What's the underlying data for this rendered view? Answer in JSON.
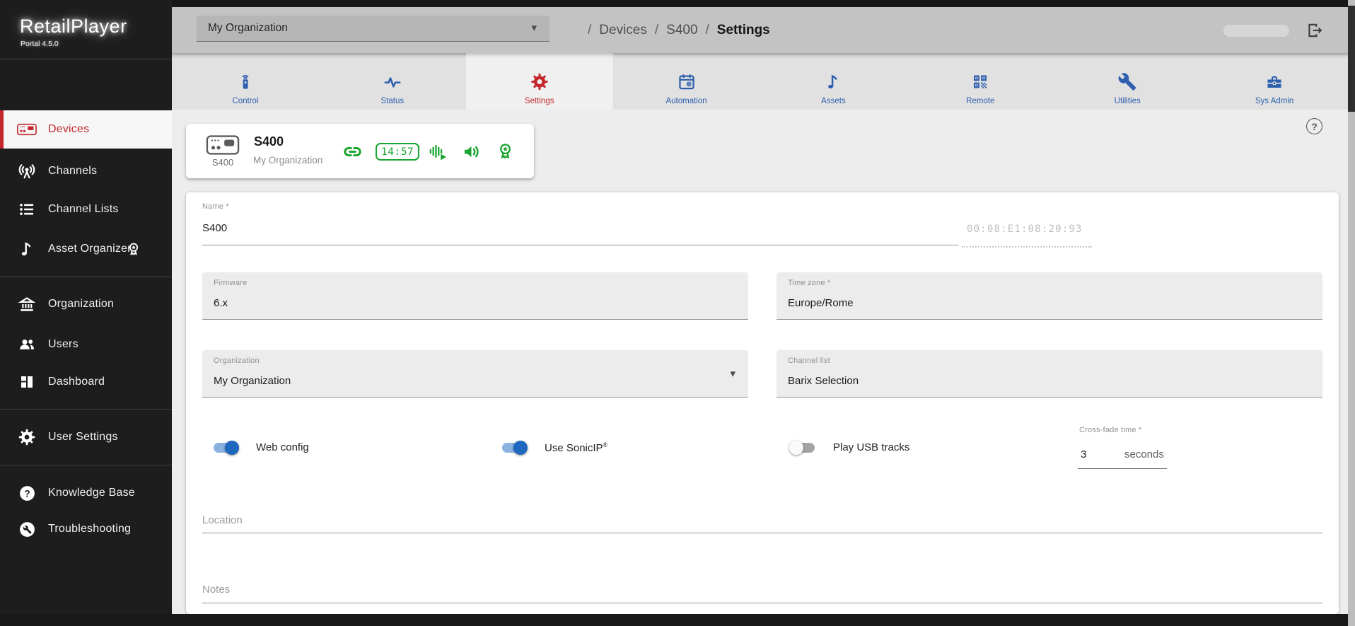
{
  "brand": {
    "title": "RetailPlayer",
    "subtitle": "Portal 4.5.0"
  },
  "topbar": {
    "org_selector_value": "My Organization",
    "breadcrumb": {
      "separator": "/",
      "crumbs": [
        "Devices",
        "S400",
        "Settings"
      ]
    }
  },
  "sidebar": {
    "items": [
      {
        "label": "Devices",
        "icon": "device-player-icon",
        "active": true
      },
      {
        "label": "Channels",
        "icon": "broadcast-icon",
        "active": false
      },
      {
        "label": "Channel Lists",
        "icon": "channel-list-icon",
        "active": false
      },
      {
        "label": "Asset Organizer",
        "icon": "music-note-icon",
        "badge_icon": "certificate-badge-icon",
        "active": false
      },
      {
        "label": "Organization",
        "icon": "bank-icon",
        "active": false
      },
      {
        "label": "Users",
        "icon": "users-icon",
        "active": false
      },
      {
        "label": "Dashboard",
        "icon": "dashboard-icon",
        "active": false
      },
      {
        "label": "User Settings",
        "icon": "gear-icon",
        "active": false
      },
      {
        "label": "Knowledge Base",
        "icon": "help-circle-icon",
        "active": false
      },
      {
        "label": "Troubleshooting",
        "icon": "wrench-circle-icon",
        "active": false
      }
    ]
  },
  "tabs": [
    {
      "label": "Control",
      "icon": "remote-control-icon",
      "active": false
    },
    {
      "label": "Status",
      "icon": "pulse-icon",
      "active": false
    },
    {
      "label": "Settings",
      "icon": "gear-icon",
      "active": true
    },
    {
      "label": "Automation",
      "icon": "automation-calendar-icon",
      "active": false
    },
    {
      "label": "Assets",
      "icon": "music-note-icon",
      "active": false
    },
    {
      "label": "Remote",
      "icon": "qr-code-icon",
      "active": false
    },
    {
      "label": "Utilities",
      "icon": "wrench-icon",
      "active": false
    },
    {
      "label": "Sys Admin",
      "icon": "toolbox-icon",
      "active": false
    }
  ],
  "device_card": {
    "model_label": "S400",
    "title": "S400",
    "organization": "My Organization",
    "clock": "14:57",
    "status_icons": [
      "link-icon",
      "clock-badge",
      "audio-playing-icon",
      "speaker-icon",
      "certificate-badge-icon"
    ]
  },
  "help": {
    "label": "?"
  },
  "form": {
    "name": {
      "label": "Name *",
      "value": "S400"
    },
    "mac_address": "00:08:E1:08:20:93",
    "firmware": {
      "label": "Firmware",
      "value": "6.x"
    },
    "timezone": {
      "label": "Time zone *",
      "value": "Europe/Rome"
    },
    "organization": {
      "label": "Organization",
      "value": "My Organization"
    },
    "channel_list": {
      "label": "Channel list",
      "value": "Barix Selection"
    },
    "toggles": [
      {
        "label": "Web config",
        "on": true
      },
      {
        "label": "Use SonicIP",
        "reg_mark": "®",
        "on": true
      },
      {
        "label": "Play USB tracks",
        "on": false
      }
    ],
    "crossfade": {
      "label": "Cross-fade time *",
      "value": "3",
      "unit": "seconds"
    },
    "location": {
      "placeholder": "Location"
    },
    "notes": {
      "placeholder": "Notes"
    }
  },
  "colors": {
    "accent_red": "#c3272b",
    "accent_blue": "#2e5fae",
    "status_green": "#18a42e",
    "toggle_on_knob": "#1e68c0",
    "toggle_on_track": "#8ab2e0"
  }
}
